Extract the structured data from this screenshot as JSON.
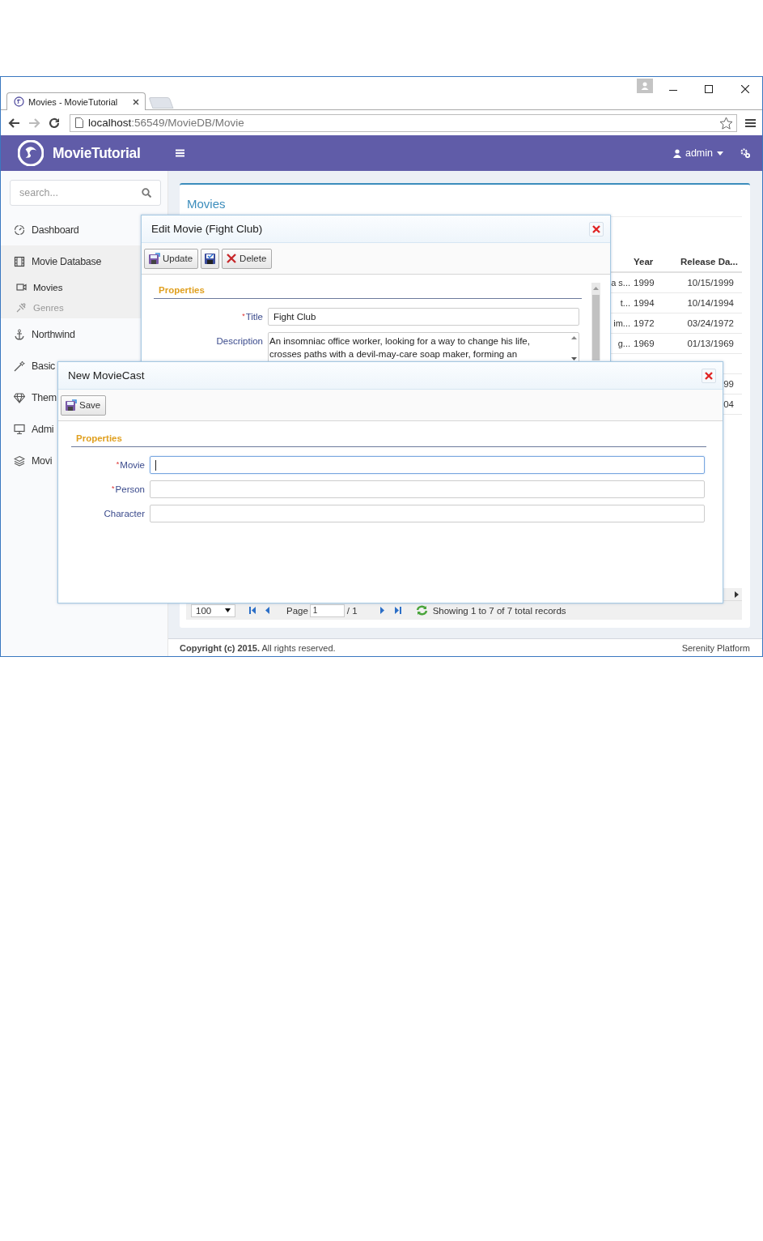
{
  "browser": {
    "tab_title": "Movies - MovieTutorial",
    "url_host": "localhost",
    "url_path": ":56549/MovieDB/Movie"
  },
  "header": {
    "brand": "MovieTutorial",
    "user": "admin"
  },
  "sidebar": {
    "search_placeholder": "search...",
    "items": [
      {
        "label": "Dashboard",
        "expanded": false
      },
      {
        "label": "Movie Database",
        "expanded": true,
        "children": [
          {
            "label": "Movies",
            "selected": true
          },
          {
            "label": "Genres",
            "selected": false
          }
        ]
      },
      {
        "label": "Northwind",
        "expanded": false
      },
      {
        "label": "Basic",
        "expanded": false
      },
      {
        "label": "Them",
        "expanded": false
      },
      {
        "label": "Admi",
        "expanded": false
      },
      {
        "label": "Movi",
        "expanded": false
      }
    ]
  },
  "main": {
    "title": "Movies",
    "grid": {
      "columns": [
        "Year",
        "Release Da..."
      ],
      "rows": [
        {
          "column_1": "a s...",
          "year": "1999",
          "release": "10/15/1999"
        },
        {
          "column_1": "t...",
          "year": "1994",
          "release": "10/14/1994"
        },
        {
          "column_1": "im...",
          "year": "1972",
          "release": "03/24/1972"
        },
        {
          "column_1": "g...",
          "year": "1969",
          "release": "01/13/1969"
        },
        {},
        {
          "release": "99"
        },
        {
          "release": "04"
        }
      ]
    },
    "pager": {
      "page_size": "100",
      "page_label": "Page",
      "page": "1",
      "page_total": "/ 1",
      "status": "Showing 1 to 7 of 7 total records"
    }
  },
  "footer": {
    "copyright": "**Copyright (c) 2015.** All rights reserved.",
    "platform": "Serenity Platform"
  },
  "edit_dialog": {
    "title": "Edit Movie (Fight Club)",
    "buttons": [
      {
        "kind": "update",
        "label": "Update"
      },
      {
        "kind": "apply"
      },
      {
        "kind": "delete",
        "label": "Delete"
      }
    ],
    "section": "Properties",
    "fields": [
      {
        "kind": "text",
        "label": "Title",
        "required_mark": "*",
        "value": "Fight Club"
      },
      {
        "kind": "textarea",
        "label": "Description",
        "value": "An insomniac office worker, looking for a way to change his life, crosses paths with a devil-may-care soap maker, forming an"
      }
    ]
  },
  "cast_dialog": {
    "title": "New MovieCast",
    "buttons": [
      {
        "kind": "save",
        "label": "Save"
      }
    ],
    "section": "Properties",
    "fields": [
      {
        "kind": "text",
        "label": "Movie",
        "required_mark": "*",
        "focused": true
      },
      {
        "kind": "text",
        "label": "Person",
        "required_mark": "*",
        "focused": false
      },
      {
        "kind": "text",
        "label": "Character",
        "focused": false
      }
    ]
  }
}
